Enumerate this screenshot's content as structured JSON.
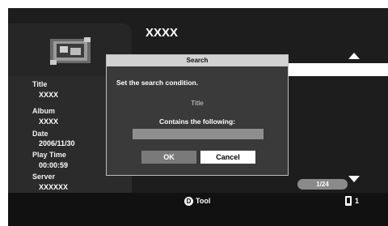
{
  "header": {
    "title": "XXXX"
  },
  "info": {
    "title_label": "Title",
    "title_value": "XXXX",
    "album_label": "Album",
    "album_value": "XXXX",
    "date_label": "Date",
    "date_value": "2006/11/30",
    "playtime_label": "Play Time",
    "playtime_value": "00:00:59",
    "server_label": "Server",
    "server_value": "XXXXXX"
  },
  "dialog": {
    "title": "Search",
    "message": "Set the search condition.",
    "field_name": "Title",
    "condition_label": "Contains the following:",
    "input_value": "",
    "ok_label": "OK",
    "cancel_label": "Cancel"
  },
  "list": {
    "page_indicator": "1/24"
  },
  "footer": {
    "tool_button_glyph": "D",
    "tool_label": "Tool",
    "counter_icon": "document-icon",
    "counter_value": "1"
  }
}
